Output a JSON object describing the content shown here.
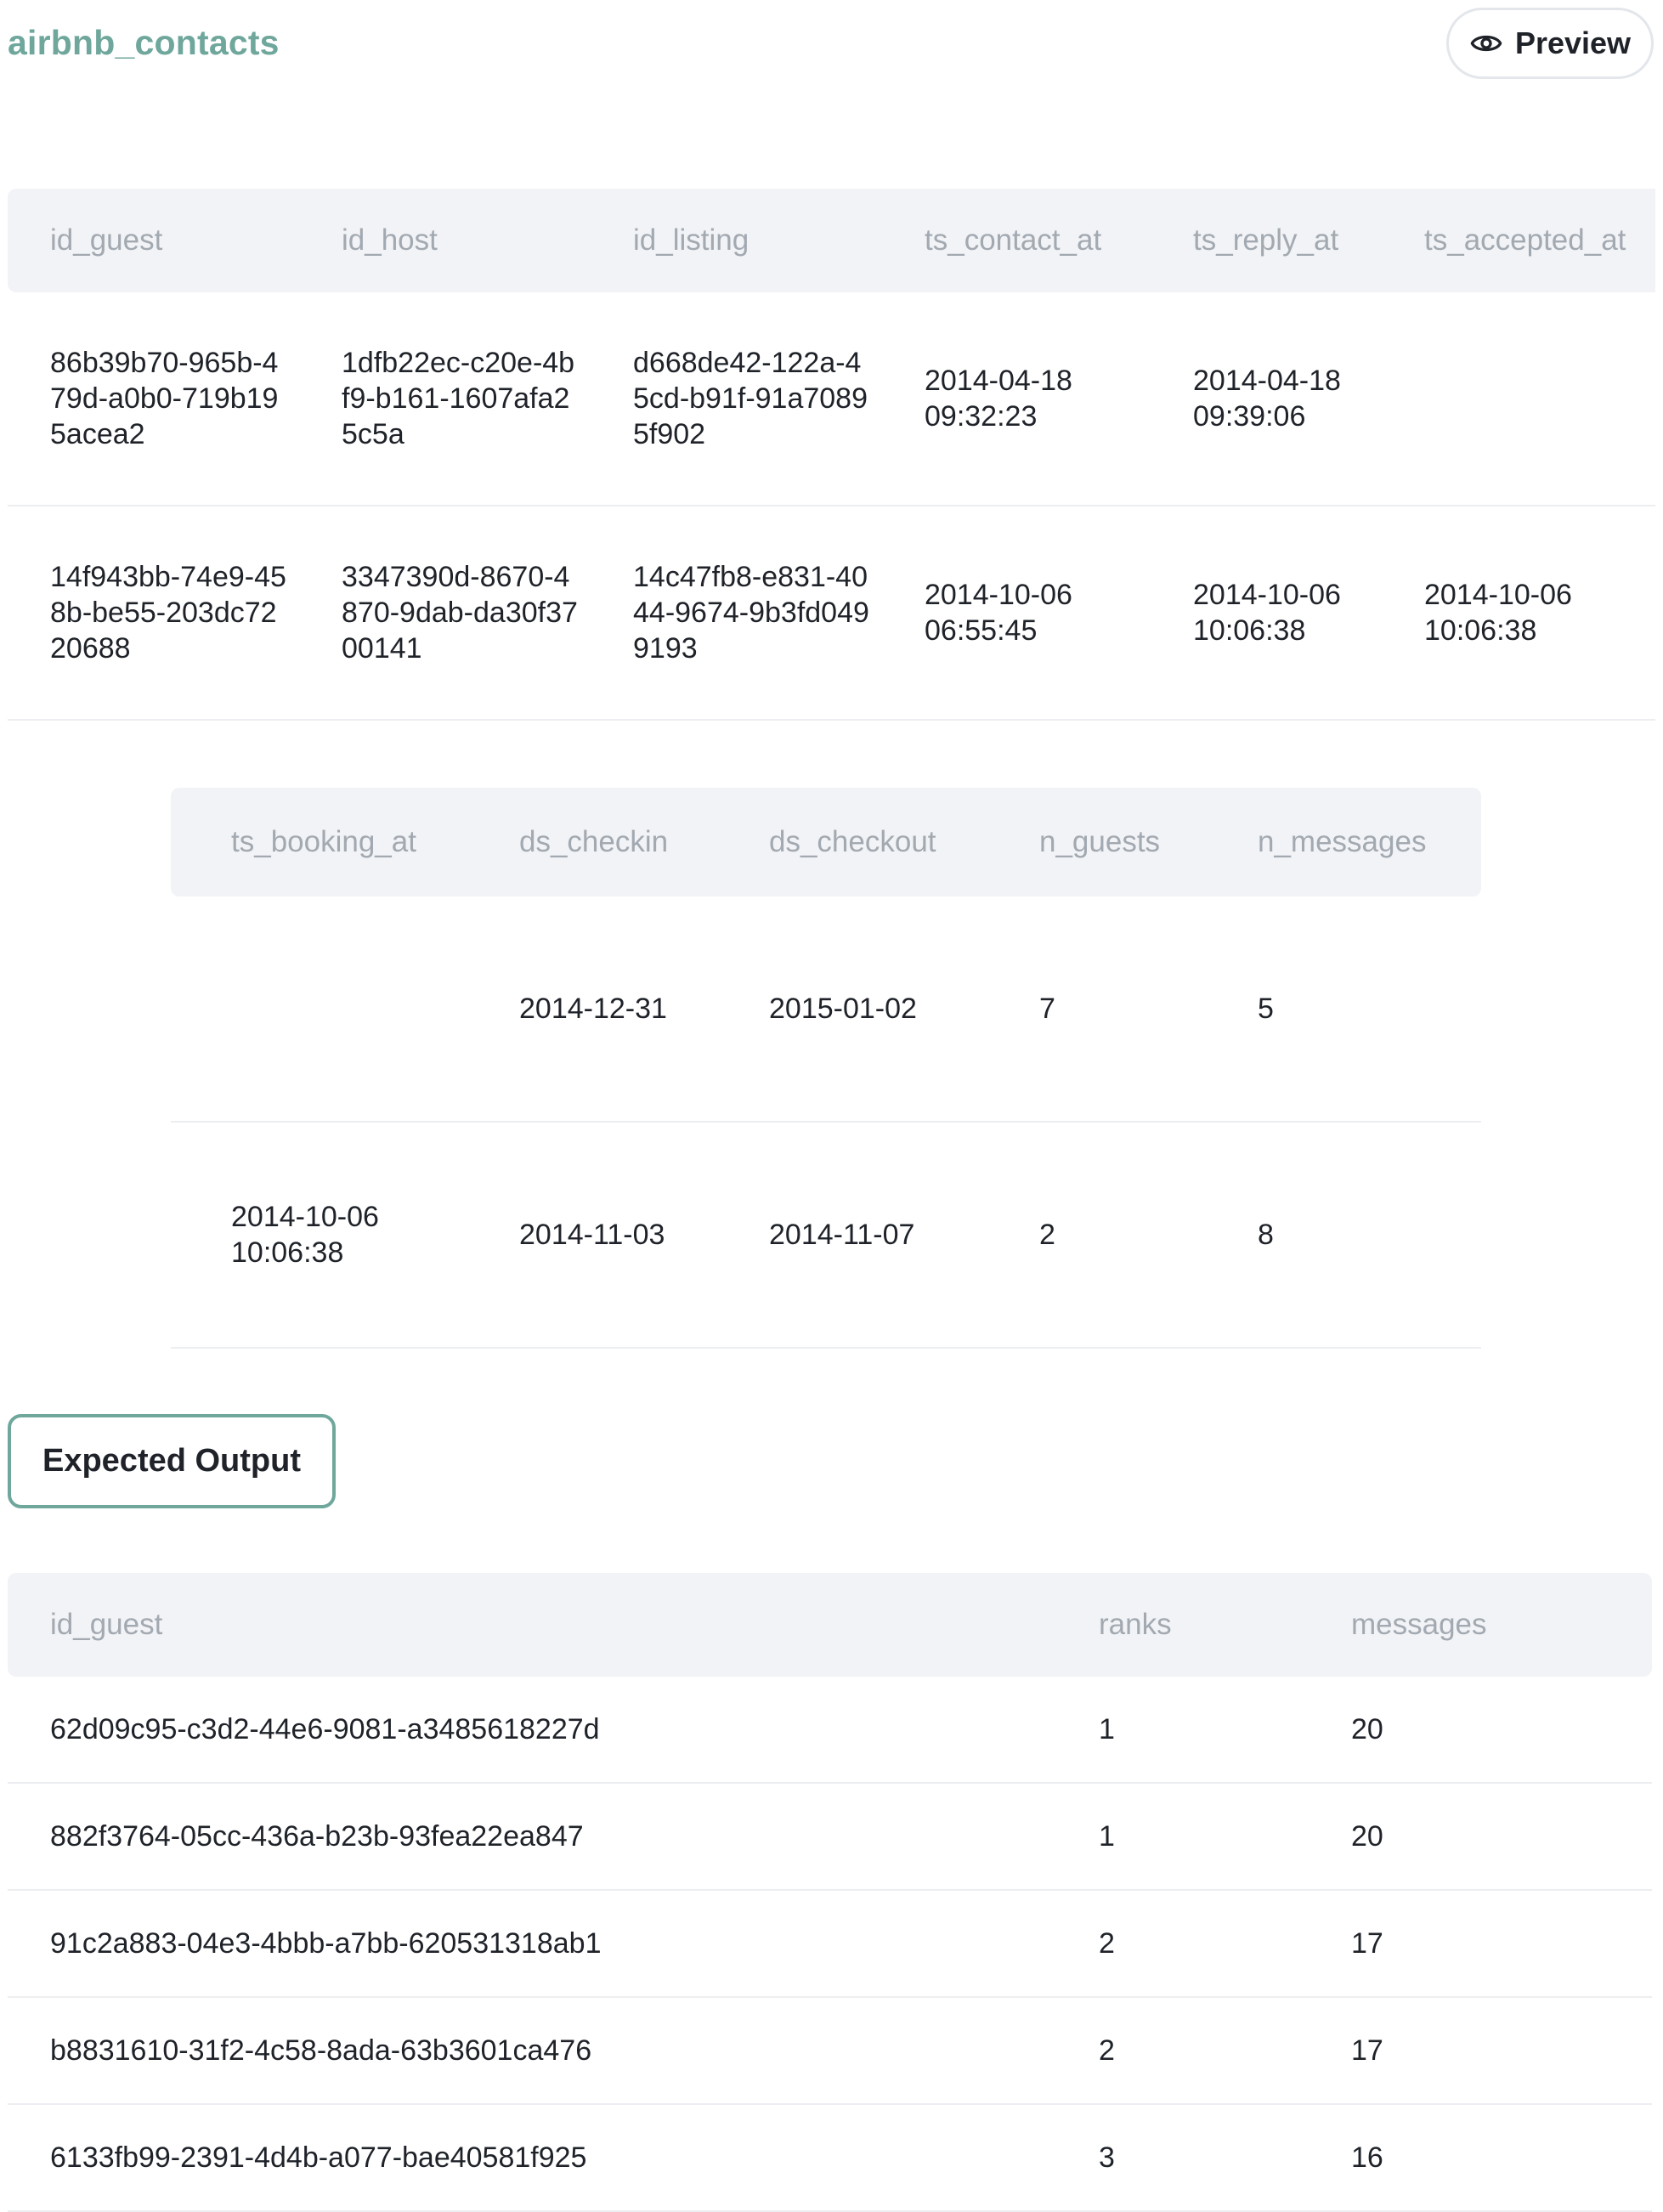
{
  "page": {
    "title": "airbnb_contacts",
    "preview_label": "Preview",
    "expected_output_label": "Expected Output"
  },
  "icons": {
    "preview": "eye-icon"
  },
  "colors": {
    "accent": "#6fa79c",
    "header_bg": "#f1f3f6",
    "header_text": "#a3a9b1"
  },
  "contacts_table": {
    "columns": [
      "id_guest",
      "id_host",
      "id_listing",
      "ts_contact_at",
      "ts_reply_at",
      "ts_accepted_at"
    ],
    "rows": [
      [
        "86b39b70-965b-479d-a0b0-719b195acea2",
        "1dfb22ec-c20e-4bf9-b161-1607afa25c5a",
        "d668de42-122a-45cd-b91f-91a70895f902",
        "2014-04-18 09:32:23",
        "2014-04-18 09:39:06",
        ""
      ],
      [
        "14f943bb-74e9-458b-be55-203dc7220688",
        "3347390d-8670-4870-9dab-da30f3700141",
        "14c47fb8-e831-4044-9674-9b3fd0499193",
        "2014-10-06 06:55:45",
        "2014-10-06 10:06:38",
        "2014-10-06 10:06:38"
      ]
    ]
  },
  "contacts_table_2": {
    "columns": [
      "ts_booking_at",
      "ds_checkin",
      "ds_checkout",
      "n_guests",
      "n_messages"
    ],
    "rows": [
      [
        "",
        "2014-12-31",
        "2015-01-02",
        "7",
        "5"
      ],
      [
        "2014-10-06 10:06:38",
        "2014-11-03",
        "2014-11-07",
        "2",
        "8"
      ]
    ]
  },
  "expected_output": {
    "columns": [
      "id_guest",
      "ranks",
      "messages"
    ],
    "rows": [
      [
        "62d09c95-c3d2-44e6-9081-a3485618227d",
        "1",
        "20"
      ],
      [
        "882f3764-05cc-436a-b23b-93fea22ea847",
        "1",
        "20"
      ],
      [
        "91c2a883-04e3-4bbb-a7bb-620531318ab1",
        "2",
        "17"
      ],
      [
        "b8831610-31f2-4c58-8ada-63b3601ca476",
        "2",
        "17"
      ],
      [
        "6133fb99-2391-4d4b-a077-bae40581f925",
        "3",
        "16"
      ]
    ]
  }
}
